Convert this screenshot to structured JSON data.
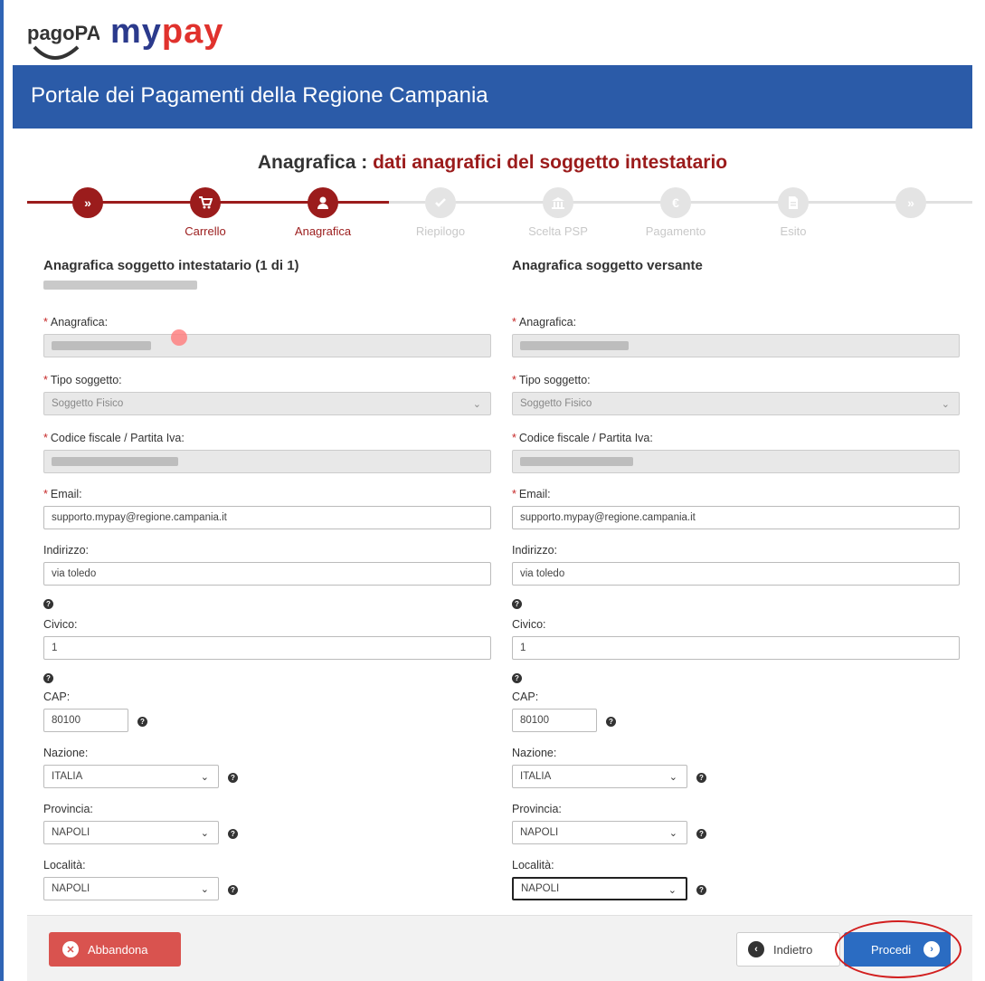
{
  "brand": {
    "pagopa_logo": "pagoPA",
    "mypay_logo": "mypay",
    "portal_title": "Portale dei Pagamenti della Regione Campania",
    "colors": {
      "title_bar": "#2b5ba8",
      "accent_red": "#9b1c1c",
      "mypay_my": "#2b3a8c",
      "mypay_pay": "#e0322d"
    }
  },
  "heading": {
    "lead": "Anagrafica : ",
    "rest": "dati anagrafici del soggetto intestatario"
  },
  "steps": [
    {
      "label": "",
      "icon": "double-chevron-icon",
      "state": "active"
    },
    {
      "label": "Carrello",
      "icon": "cart-icon",
      "state": "active"
    },
    {
      "label": "Anagrafica",
      "icon": "user-icon",
      "state": "active"
    },
    {
      "label": "Riepilogo",
      "icon": "check-icon",
      "state": "inactive"
    },
    {
      "label": "Scelta PSP",
      "icon": "bank-icon",
      "state": "inactive"
    },
    {
      "label": "Pagamento",
      "icon": "euro-icon",
      "state": "inactive"
    },
    {
      "label": "Esito",
      "icon": "document-icon",
      "state": "inactive"
    },
    {
      "label": "",
      "icon": "double-chevron-icon",
      "state": "inactive"
    }
  ],
  "intestatario": {
    "title": "Anagrafica soggetto intestatario (1 di 1)",
    "anagrafica_label": "Anagrafica:",
    "tipo_label": "Tipo soggetto:",
    "tipo_value": "Soggetto Fisico",
    "cf_label": "Codice fiscale / Partita Iva:",
    "email_label": "Email:",
    "email_value": "supporto.mypay@regione.campania.it",
    "indirizzo_label": "Indirizzo:",
    "indirizzo_value": "via toledo",
    "civico_label": "Civico:",
    "civico_value": "1",
    "cap_label": "CAP:",
    "cap_value": "80100",
    "nazione_label": "Nazione:",
    "nazione_value": "ITALIA",
    "provincia_label": "Provincia:",
    "provincia_value": "NAPOLI",
    "localita_label": "Località:",
    "localita_value": "NAPOLI"
  },
  "versante": {
    "title": "Anagrafica soggetto versante",
    "anagrafica_label": "Anagrafica:",
    "tipo_label": "Tipo soggetto:",
    "tipo_value": "Soggetto Fisico",
    "cf_label": "Codice fiscale / Partita Iva:",
    "email_label": "Email:",
    "email_value": "supporto.mypay@regione.campania.it",
    "indirizzo_label": "Indirizzo:",
    "indirizzo_value": "via toledo",
    "civico_label": "Civico:",
    "civico_value": "1",
    "cap_label": "CAP:",
    "cap_value": "80100",
    "nazione_label": "Nazione:",
    "nazione_value": "ITALIA",
    "provincia_label": "Provincia:",
    "provincia_value": "NAPOLI",
    "localita_label": "Località:",
    "localita_value": "NAPOLI"
  },
  "footer": {
    "abbandona": "Abbandona",
    "indietro": "Indietro",
    "procedi": "Procedi"
  }
}
